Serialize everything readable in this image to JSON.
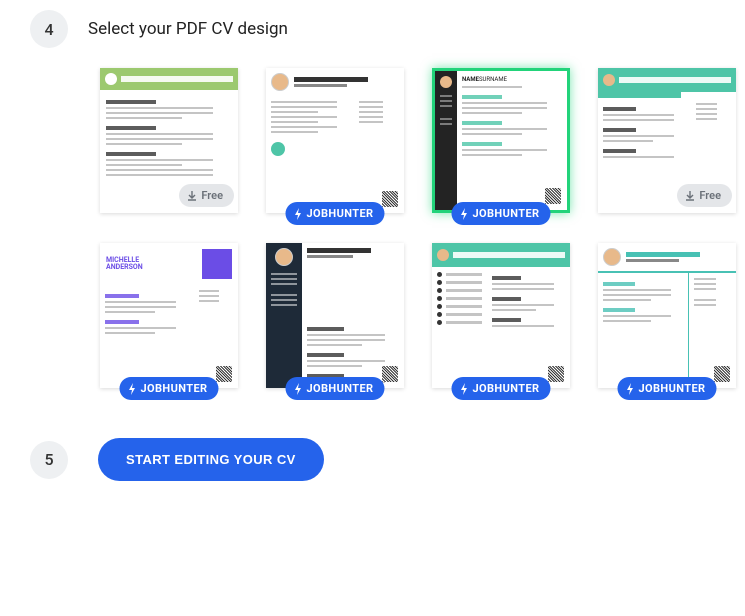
{
  "steps": {
    "design": {
      "number": "4",
      "title": "Select your PDF CV design"
    },
    "cta": {
      "number": "5",
      "button": "START EDITING YOUR CV"
    }
  },
  "badges": {
    "free": "Free",
    "jobhunter": "JOBHUNTER"
  },
  "templates": [
    {
      "id": "tpl-green-header",
      "badge": "free",
      "selected": false,
      "variant": "green-banner"
    },
    {
      "id": "tpl-minimal-teal",
      "badge": "jobhunter",
      "selected": false,
      "variant": "minimal-teal-dot"
    },
    {
      "id": "tpl-sidebar-name",
      "badge": "jobhunter",
      "selected": true,
      "variant": "black-side-name"
    },
    {
      "id": "tpl-teal-header",
      "badge": "free",
      "selected": false,
      "variant": "teal-banner"
    },
    {
      "id": "tpl-purple-modern",
      "badge": "jobhunter",
      "selected": false,
      "variant": "purple"
    },
    {
      "id": "tpl-dark-sidebar",
      "badge": "jobhunter",
      "selected": false,
      "variant": "dark-side"
    },
    {
      "id": "tpl-teal-bullets",
      "badge": "jobhunter",
      "selected": false,
      "variant": "teal-bullets"
    },
    {
      "id": "tpl-teal-two-col",
      "badge": "jobhunter",
      "selected": false,
      "variant": "teal-two-col"
    }
  ],
  "colors": {
    "accent_teal": "#4ec5a7",
    "accent_blue": "#2563eb",
    "selected_glow": "#22d37a"
  }
}
